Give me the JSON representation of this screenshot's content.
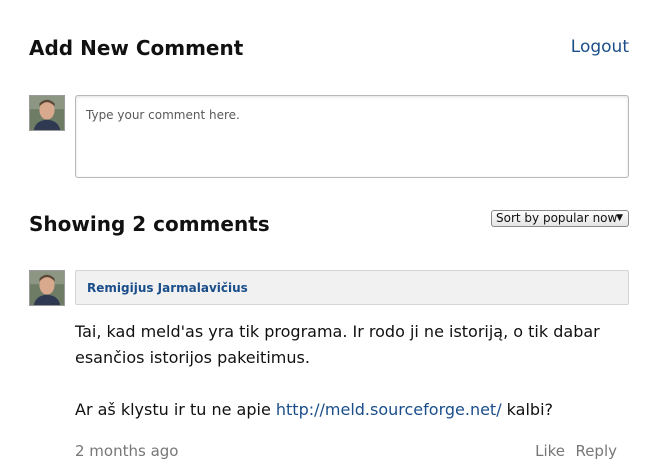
{
  "add_comment": {
    "title": "Add New Comment",
    "logout_label": "Logout",
    "input_placeholder": "Type your comment here."
  },
  "comments_header": {
    "showing_label": "Showing 2 comments",
    "sort_selected": "Sort by popular now",
    "sort_arrow_icon": "triangle-down-icon"
  },
  "comment": {
    "author": "Remigijus Jarmalavičius",
    "paragraph1": "Tai, kad meld'as yra tik programa. Ir rodo ji ne istoriją, o tik dabar esančios istorijos pakeitimus.",
    "paragraph2_before": "Ar aš klystu ir tu ne apie ",
    "paragraph2_link": "http://meld.sourceforge.net/",
    "paragraph2_after": " kalbi?",
    "timestamp": "2 months ago",
    "like_label": "Like",
    "reply_label": "Reply"
  },
  "colors": {
    "link": "#1a4e8a",
    "author_bar_bg": "#f1f1f1",
    "meta_text": "#777777"
  }
}
